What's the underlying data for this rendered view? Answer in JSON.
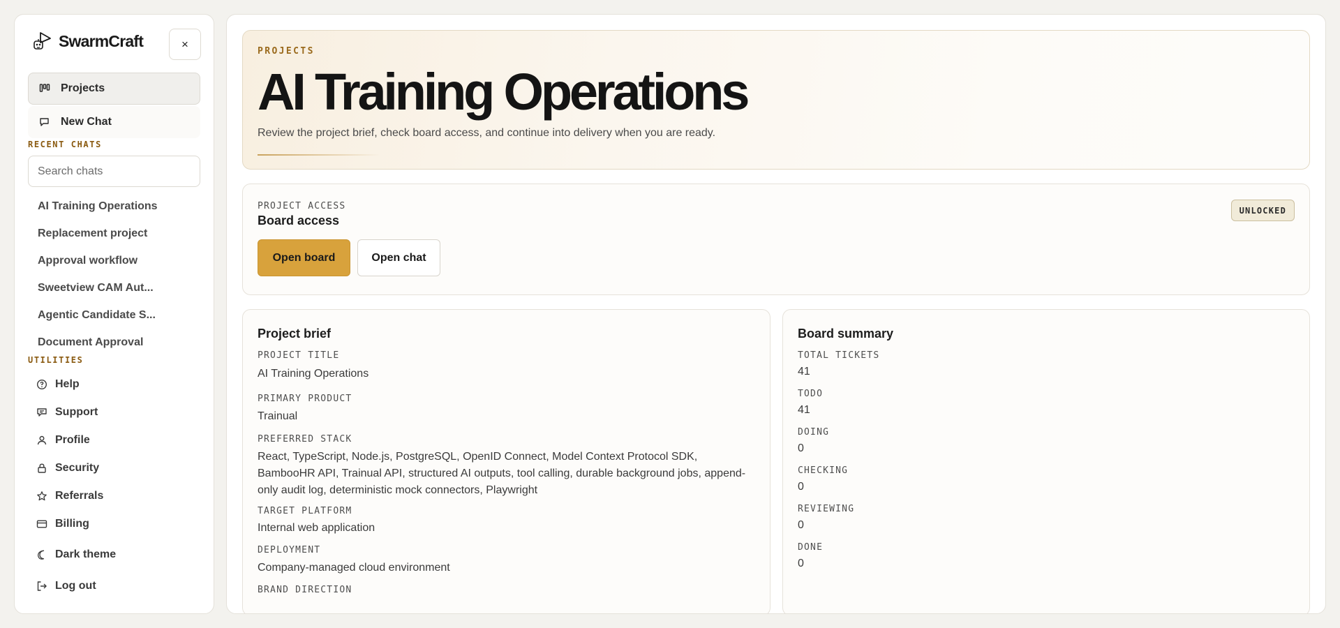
{
  "app": {
    "name": "SwarmCraft"
  },
  "sidebar": {
    "close_label": "×",
    "nav": [
      {
        "label": "Projects",
        "icon": "kanban-icon"
      },
      {
        "label": "New Chat",
        "icon": "chat-icon"
      }
    ],
    "recent_label": "RECENT CHATS",
    "search_placeholder": "Search chats",
    "chats": [
      "AI Training Operations",
      "Replacement project",
      "Approval workflow",
      "Sweetview CAM Aut...",
      "Agentic Candidate S...",
      "Document Approval"
    ],
    "utilities_label": "UTILITIES",
    "utilities": [
      {
        "label": "Help",
        "icon": "help-icon"
      },
      {
        "label": "Support",
        "icon": "support-icon"
      },
      {
        "label": "Profile",
        "icon": "profile-icon"
      },
      {
        "label": "Security",
        "icon": "lock-icon"
      },
      {
        "label": "Referrals",
        "icon": "star-icon"
      },
      {
        "label": "Billing",
        "icon": "card-icon"
      },
      {
        "label": "Dark theme",
        "icon": "moon-icon"
      },
      {
        "label": "Log out",
        "icon": "logout-icon"
      }
    ]
  },
  "hero": {
    "kicker": "PROJECTS",
    "title": "AI Training Operations",
    "subtitle": "Review the project brief, check board access, and continue into delivery when you are ready."
  },
  "access": {
    "label": "PROJECT ACCESS",
    "title": "Board access",
    "badge": "UNLOCKED",
    "open_board": "Open board",
    "open_chat": "Open chat"
  },
  "brief": {
    "title": "Project brief",
    "fields": [
      {
        "label": "PROJECT TITLE",
        "value": "AI Training Operations"
      },
      {
        "label": "PRIMARY PRODUCT",
        "value": "Trainual"
      },
      {
        "label": "PREFERRED STACK",
        "value": "React, TypeScript, Node.js, PostgreSQL, OpenID Connect, Model Context Protocol SDK, BambooHR API, Trainual API, structured AI outputs, tool calling, durable background jobs, append-only audit log, deterministic mock connectors, Playwright"
      },
      {
        "label": "TARGET PLATFORM",
        "value": "Internal web application"
      },
      {
        "label": "DEPLOYMENT",
        "value": "Company-managed cloud environment"
      },
      {
        "label": "BRAND DIRECTION",
        "value": ""
      }
    ]
  },
  "summary": {
    "title": "Board summary",
    "stats": [
      {
        "label": "TOTAL TICKETS",
        "value": "41"
      },
      {
        "label": "TODO",
        "value": "41"
      },
      {
        "label": "DOING",
        "value": "0"
      },
      {
        "label": "CHECKING",
        "value": "0"
      },
      {
        "label": "REVIEWING",
        "value": "0"
      },
      {
        "label": "DONE",
        "value": "0"
      }
    ]
  },
  "colors": {
    "accent": "#d8a23c",
    "kicker": "#9a6a1c",
    "section_label": "#8a5a10"
  }
}
